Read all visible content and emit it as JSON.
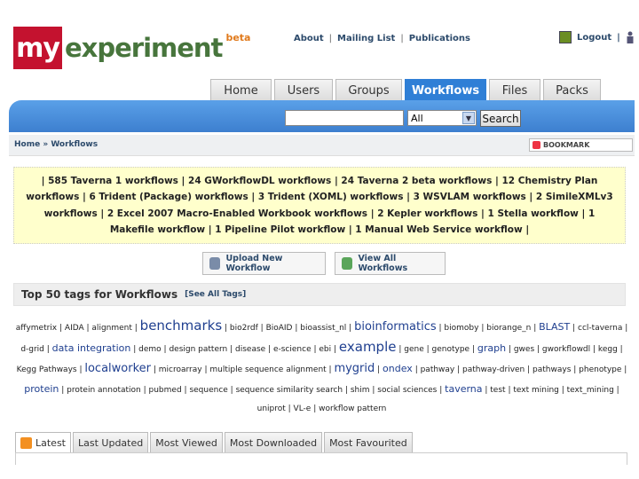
{
  "logo": {
    "my": "my",
    "experiment": "experiment",
    "beta": "beta"
  },
  "top_links": [
    "About",
    "Mailing List",
    "Publications"
  ],
  "user_links": {
    "logout": "Logout"
  },
  "tabs": [
    "Home",
    "Users",
    "Groups",
    "Workflows",
    "Files",
    "Packs"
  ],
  "active_tab": "Workflows",
  "search": {
    "value": "",
    "select_value": "All",
    "button": "Search"
  },
  "breadcrumb": {
    "home": "Home",
    "sep": "»",
    "current": "Workflows"
  },
  "bookmark_label": "BOOKMARK",
  "workflow_types": "| 585 Taverna 1 workflows | 24 GWorkflowDL workflows | 24 Taverna 2 beta workflows | 12 Chemistry Plan workflows | 6 Trident (Package) workflows | 3 Trident (XOML) workflows | 3 WSVLAM workflows | 2 SimileXMLv3 workflows | 2 Excel 2007 Macro-Enabled Workbook workflows | 2 Kepler workflows | 1 Stella workflow | 1 Makefile workflow | 1 Pipeline Pilot workflow | 1 Manual Web Service workflow |",
  "actions": {
    "upload": "Upload New Workflow",
    "view_all": "View All Workflows"
  },
  "tags_header": {
    "title": "Top 50 tags for Workflows",
    "see_all": "[See All Tags]"
  },
  "tags": [
    {
      "t": "affymetrix",
      "s": ""
    },
    {
      "t": "AIDA",
      "s": ""
    },
    {
      "t": "alignment",
      "s": ""
    },
    {
      "t": "benchmarks",
      "s": "big"
    },
    {
      "t": "bio2rdf",
      "s": ""
    },
    {
      "t": "BioAID",
      "s": ""
    },
    {
      "t": "bioassist_nl",
      "s": ""
    },
    {
      "t": "bioinformatics",
      "s": "mid"
    },
    {
      "t": "biomoby",
      "s": ""
    },
    {
      "t": "biorange_n",
      "s": ""
    },
    {
      "t": "BLAST",
      "s": "sm2"
    },
    {
      "t": "ccl-taverna",
      "s": ""
    },
    {
      "t": "d-grid",
      "s": ""
    },
    {
      "t": "data integration",
      "s": "sm2"
    },
    {
      "t": "demo",
      "s": ""
    },
    {
      "t": "design pattern",
      "s": ""
    },
    {
      "t": "disease",
      "s": ""
    },
    {
      "t": "e-science",
      "s": ""
    },
    {
      "t": "ebi",
      "s": ""
    },
    {
      "t": "example",
      "s": "big"
    },
    {
      "t": "gene",
      "s": ""
    },
    {
      "t": "genotype",
      "s": ""
    },
    {
      "t": "graph",
      "s": "sm2"
    },
    {
      "t": "gwes",
      "s": ""
    },
    {
      "t": "gworkflowdl",
      "s": ""
    },
    {
      "t": "kegg",
      "s": ""
    },
    {
      "t": "Kegg Pathways",
      "s": ""
    },
    {
      "t": "localworker",
      "s": "mid"
    },
    {
      "t": "microarray",
      "s": ""
    },
    {
      "t": "multiple sequence alignment",
      "s": ""
    },
    {
      "t": "mygrid",
      "s": "mid"
    },
    {
      "t": "ondex",
      "s": "sm2"
    },
    {
      "t": "pathway",
      "s": ""
    },
    {
      "t": "pathway-driven",
      "s": ""
    },
    {
      "t": "pathways",
      "s": ""
    },
    {
      "t": "phenotype",
      "s": ""
    },
    {
      "t": "protein",
      "s": "sm2"
    },
    {
      "t": "protein annotation",
      "s": ""
    },
    {
      "t": "pubmed",
      "s": ""
    },
    {
      "t": "sequence",
      "s": ""
    },
    {
      "t": "sequence similarity search",
      "s": ""
    },
    {
      "t": "shim",
      "s": ""
    },
    {
      "t": "social sciences",
      "s": ""
    },
    {
      "t": "taverna",
      "s": "sm2"
    },
    {
      "t": "test",
      "s": ""
    },
    {
      "t": "text mining",
      "s": ""
    },
    {
      "t": "text_mining",
      "s": ""
    },
    {
      "t": "uniprot",
      "s": ""
    },
    {
      "t": "VL-e",
      "s": ""
    },
    {
      "t": "workflow pattern",
      "s": ""
    }
  ],
  "bottom_tabs": [
    "Latest",
    "Last Updated",
    "Most Viewed",
    "Most Downloaded",
    "Most Favourited"
  ],
  "colors": {
    "brand_red": "#c4122f",
    "brand_green": "#47753c",
    "nav_blue": "#2f7fd6",
    "types_bg": "#ffffcc"
  }
}
